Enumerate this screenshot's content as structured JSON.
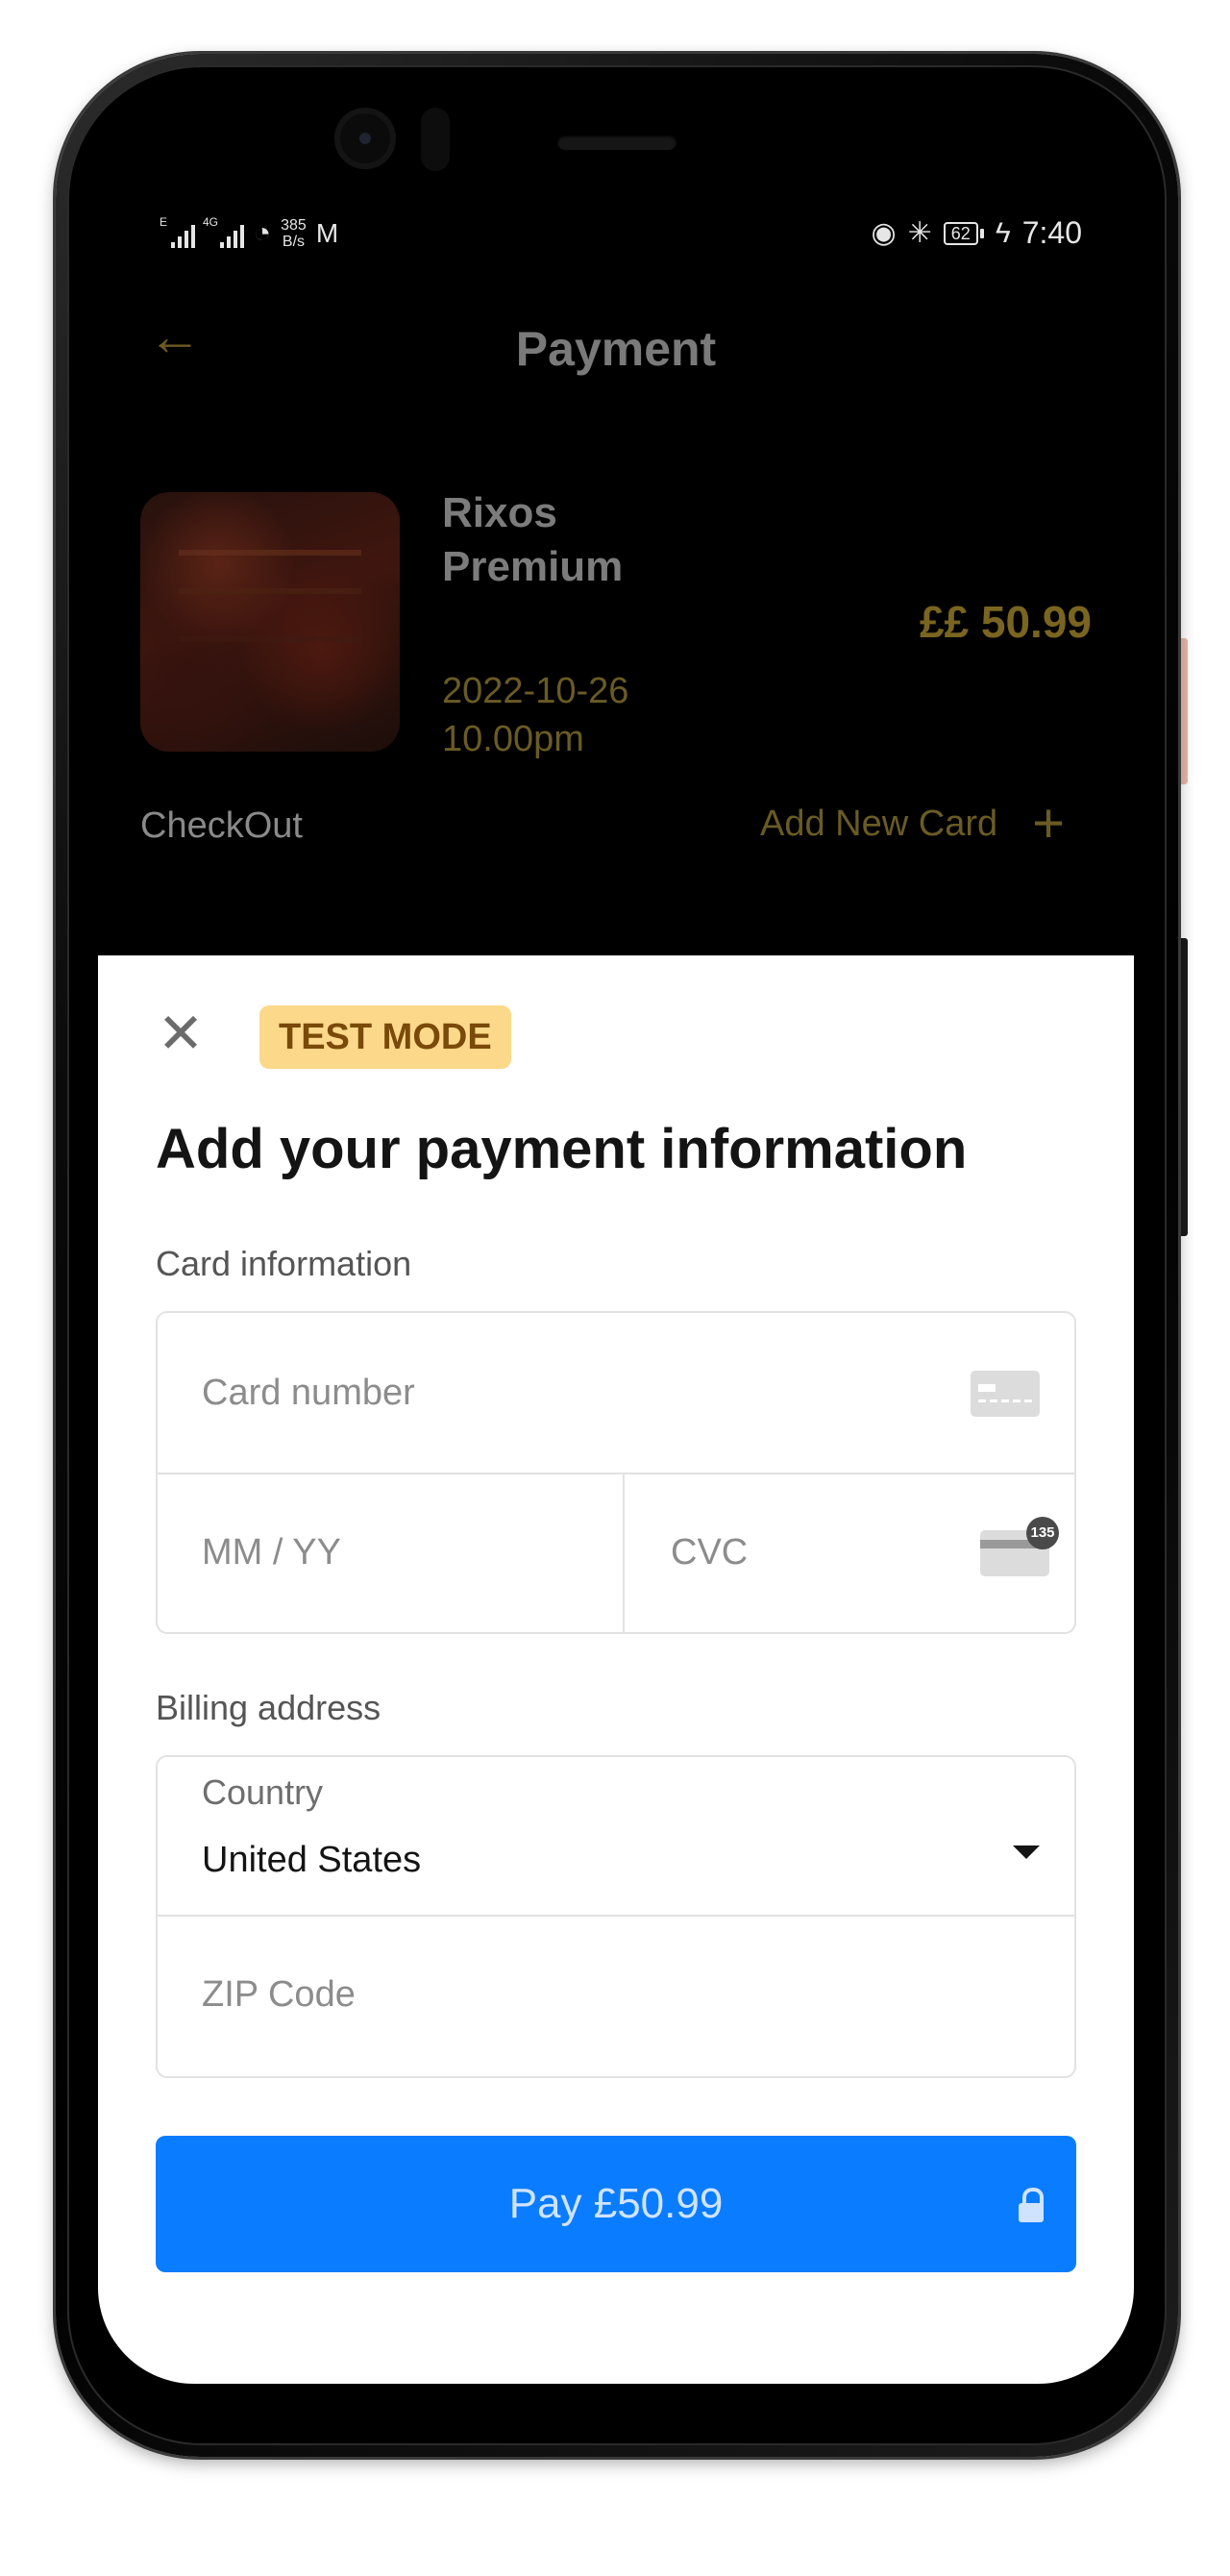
{
  "status_bar": {
    "signal_tag_1": "E",
    "signal_tag_2": "4G",
    "net_speed_value": "385",
    "net_speed_unit": "B/s",
    "battery_level": "62",
    "time": "7:40"
  },
  "header": {
    "title": "Payment",
    "back_icon": "arrow-left-icon"
  },
  "event": {
    "name_line1": "Rixos",
    "name_line2": "Premium",
    "date": "2022-10-26",
    "time": "10.00pm",
    "price": "££ 50.99"
  },
  "checkout": {
    "label": "CheckOut",
    "add_card_label": "Add New Card",
    "add_icon": "plus-icon"
  },
  "sheet": {
    "test_badge": "TEST MODE",
    "heading": "Add your payment information",
    "card_section_label": "Card information",
    "card_number_placeholder": "Card number",
    "expiry_placeholder": "MM / YY",
    "cvc_placeholder": "CVC",
    "cvc_badge": "135",
    "billing_section_label": "Billing address",
    "country_label": "Country",
    "country_value": "United States",
    "zip_placeholder": "ZIP Code",
    "pay_button_label": "Pay £50.99"
  },
  "colors": {
    "accent_gold": "#6a5b24",
    "pay_blue": "#0a7cff",
    "test_badge_bg": "#fcd98a"
  }
}
